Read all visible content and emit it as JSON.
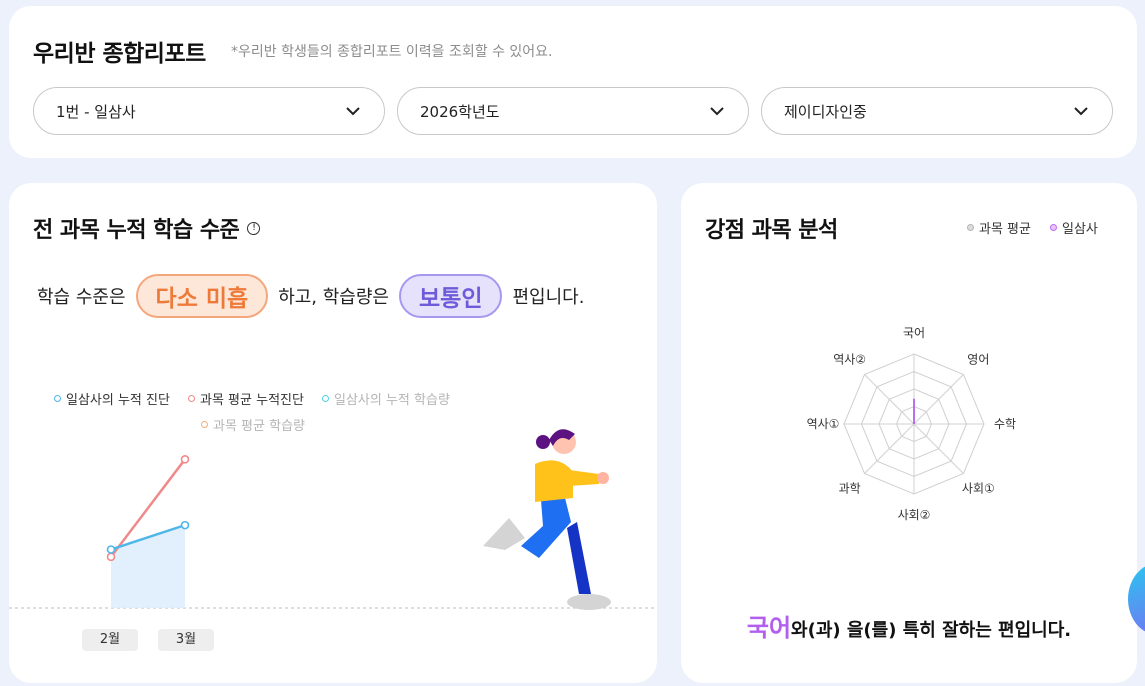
{
  "header": {
    "title": "우리반 종합리포트",
    "subtitle": "*우리반 학생들의 종합리포트 이력을 조회할 수 있어요.",
    "selects": [
      {
        "value": "1번 - 일삼사"
      },
      {
        "value": "2026학년도"
      },
      {
        "value": "제이디자인중"
      }
    ]
  },
  "cumulative": {
    "title": "전 과목 누적 학습 수준",
    "info_icon": "info-icon",
    "summary": {
      "prefix": "학습 수준은",
      "level": "다소 미흡",
      "middle": "하고, 학습량은",
      "volume": "보통인",
      "suffix": "편입니다."
    },
    "legend": [
      {
        "label": "일삼사의 누적 진단",
        "color": "#4fb6ea"
      },
      {
        "label": "과목 평균 누적진단",
        "color": "#f08a8a"
      },
      {
        "label": "일삼사의 누적 학습량",
        "color": "#4fd6e3"
      },
      {
        "label": "과목 평균 학습량",
        "color": "#f4b07a"
      }
    ]
  },
  "chart_data": [
    {
      "type": "line",
      "categories": [
        "2월",
        "3월"
      ],
      "series": [
        {
          "name": "일삼사의 누적 진단",
          "values": [
            38,
            58
          ]
        },
        {
          "name": "과목 평균 누적진단",
          "values": [
            32,
            112
          ]
        },
        {
          "name": "일삼사의 누적 학습량",
          "values": [
            38,
            58
          ]
        }
      ],
      "ylim": [
        -10,
        150
      ]
    },
    {
      "type": "radar",
      "axes": [
        "국어",
        "영어",
        "수학",
        "사회①",
        "사회②",
        "과학",
        "역사①",
        "역사②"
      ],
      "series": [
        {
          "name": "과목 평균",
          "values": [
            0,
            0,
            0,
            0,
            0,
            0,
            0,
            0
          ]
        },
        {
          "name": "일삼사",
          "values": [
            36,
            0,
            0,
            0,
            0,
            0,
            0,
            0
          ]
        }
      ],
      "rmax": 100,
      "rings": 4
    }
  ],
  "strength": {
    "title": "강점 과목 분석",
    "legend": [
      {
        "label": "과목 평균",
        "color": "#b5b5b5"
      },
      {
        "label": "일삼사",
        "color": "#c26cf2"
      }
    ],
    "subject": "국어",
    "sentence": "와(과) 을(를) 특히 잘하는 편입니다."
  }
}
